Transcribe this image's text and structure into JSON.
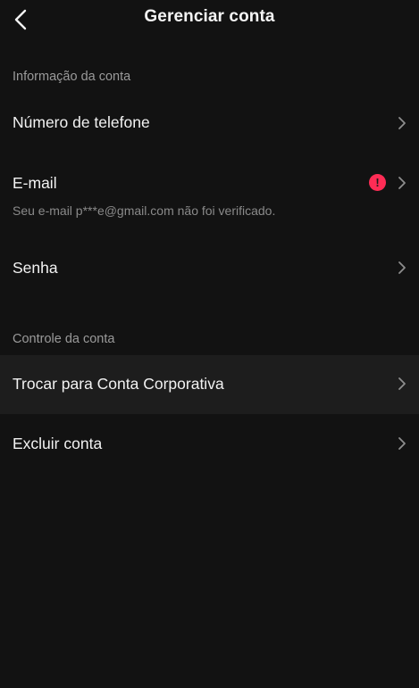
{
  "header": {
    "title": "Gerenciar conta"
  },
  "sections": {
    "account_info": {
      "label": "Informação da conta",
      "items": {
        "phone": {
          "label": "Número de telefone"
        },
        "email": {
          "label": "E-mail",
          "subtitle": "Seu e-mail p***e@gmail.com não foi verificado.",
          "alert": "!"
        },
        "password": {
          "label": "Senha"
        }
      }
    },
    "account_control": {
      "label": "Controle da conta",
      "items": {
        "switch_business": {
          "label": "Trocar para Conta Corporativa"
        },
        "delete": {
          "label": "Excluir conta"
        }
      }
    }
  },
  "colors": {
    "background": "#121212",
    "highlight_row": "#1d1d1d",
    "alert": "#fe2c55",
    "section_text": "#9a9a9a",
    "subtitle_text": "#8a8a8a"
  },
  "icons": {
    "back": "chevron-left-icon",
    "row_arrow": "chevron-right-icon",
    "alert": "exclamation-circle-icon"
  }
}
